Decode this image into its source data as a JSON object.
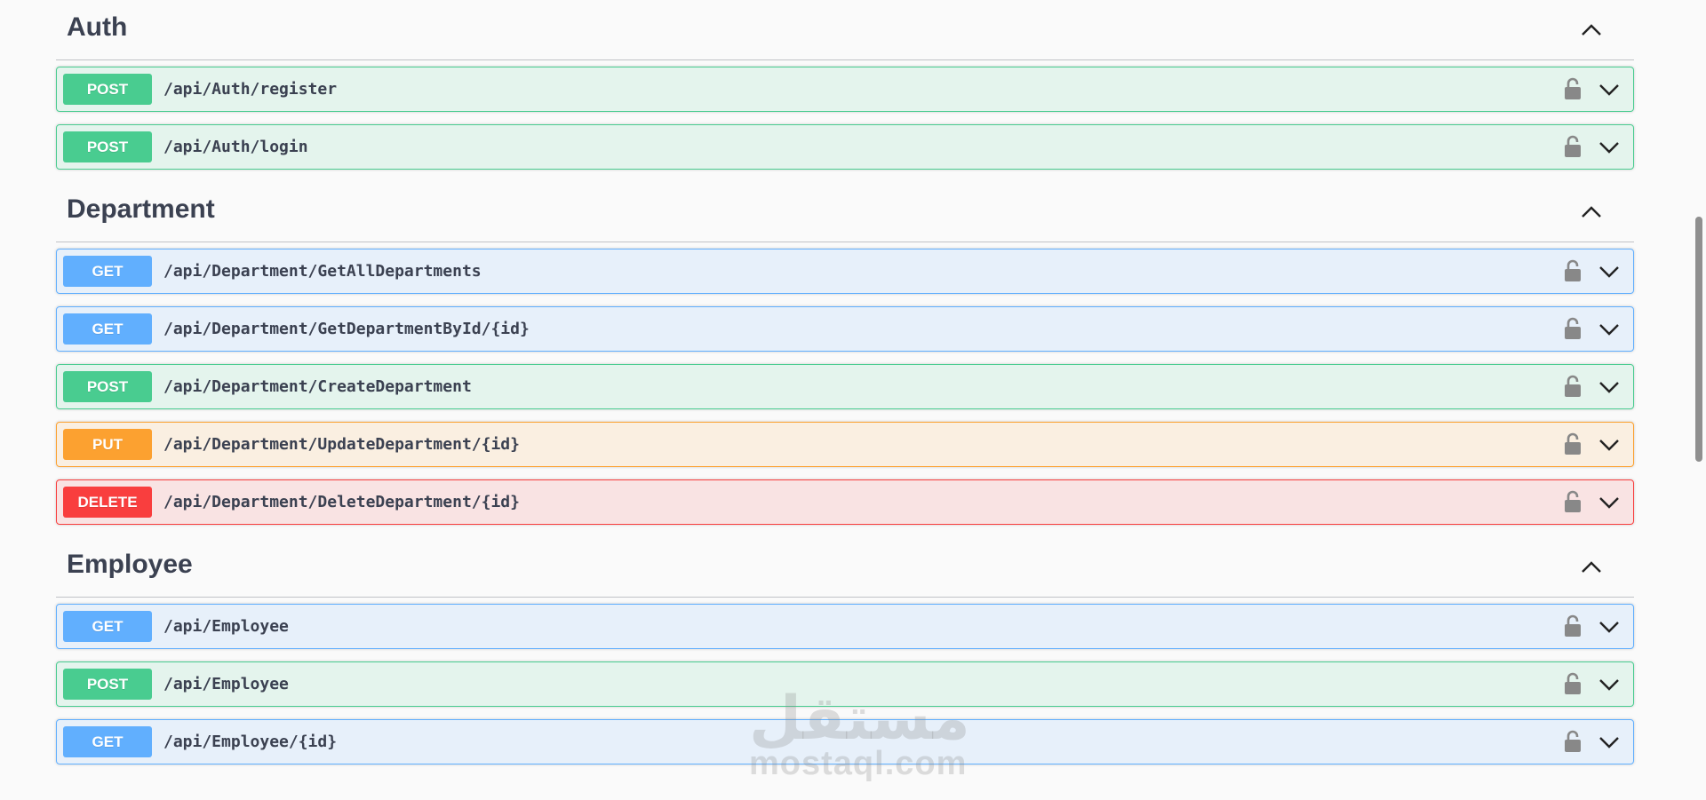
{
  "sections": [
    {
      "title": "Auth",
      "operations": [
        {
          "method": "POST",
          "path": "/api/Auth/register"
        },
        {
          "method": "POST",
          "path": "/api/Auth/login"
        }
      ]
    },
    {
      "title": "Department",
      "operations": [
        {
          "method": "GET",
          "path": "/api/Department/GetAllDepartments"
        },
        {
          "method": "GET",
          "path": "/api/Department/GetDepartmentById/{id}"
        },
        {
          "method": "POST",
          "path": "/api/Department/CreateDepartment"
        },
        {
          "method": "PUT",
          "path": "/api/Department/UpdateDepartment/{id}"
        },
        {
          "method": "DELETE",
          "path": "/api/Department/DeleteDepartment/{id}"
        }
      ]
    },
    {
      "title": "Employee",
      "operations": [
        {
          "method": "GET",
          "path": "/api/Employee"
        },
        {
          "method": "POST",
          "path": "/api/Employee"
        },
        {
          "method": "GET",
          "path": "/api/Employee/{id}"
        }
      ]
    }
  ],
  "icons": {
    "section_toggle": "chevron-up-icon",
    "lock": "lock-icon",
    "expand": "chevron-down-icon"
  },
  "colors": {
    "POST": "#49cc90",
    "GET": "#61affe",
    "PUT": "#fca130",
    "DELETE": "#f93e3e",
    "text": "#3b4151"
  },
  "watermark": {
    "logo": "مستقل",
    "domain": "mostaql.com"
  }
}
